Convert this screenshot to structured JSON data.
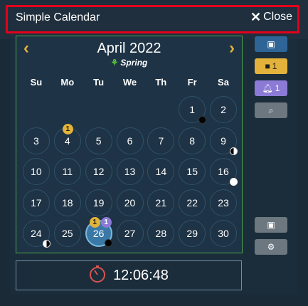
{
  "window": {
    "title": "Simple Calendar",
    "close_label": "Close"
  },
  "calendar": {
    "month_title": "April 2022",
    "season": "Spring",
    "weekdays": [
      "Su",
      "Mo",
      "Tu",
      "We",
      "Th",
      "Fr",
      "Sa"
    ],
    "days": [
      {
        "n": "1",
        "moon": "new"
      },
      {
        "n": "2"
      },
      {
        "n": "3"
      },
      {
        "n": "4",
        "notes": "1"
      },
      {
        "n": "5"
      },
      {
        "n": "6"
      },
      {
        "n": "7"
      },
      {
        "n": "8"
      },
      {
        "n": "9",
        "moon": "first"
      },
      {
        "n": "10"
      },
      {
        "n": "11"
      },
      {
        "n": "12"
      },
      {
        "n": "13"
      },
      {
        "n": "14"
      },
      {
        "n": "15"
      },
      {
        "n": "16",
        "moon": "full"
      },
      {
        "n": "17"
      },
      {
        "n": "18"
      },
      {
        "n": "19"
      },
      {
        "n": "20"
      },
      {
        "n": "21"
      },
      {
        "n": "22"
      },
      {
        "n": "23"
      },
      {
        "n": "24",
        "moon": "last"
      },
      {
        "n": "25"
      },
      {
        "n": "26",
        "notes": "1",
        "reminders": "1",
        "today": true,
        "moon": "new"
      },
      {
        "n": "27"
      },
      {
        "n": "28"
      },
      {
        "n": "29"
      },
      {
        "n": "30"
      }
    ],
    "first_weekday_index": 5
  },
  "sidebar": {
    "notes_count": "1",
    "reminders_count": "1"
  },
  "clock": {
    "time": "12:06:48"
  },
  "colors": {
    "accent_yellow": "#e2b23a",
    "accent_purple": "#8c7bd6",
    "calendar_border": "#4ea64d",
    "highlight_red": "#e3001b"
  },
  "icons": [
    "close-icon",
    "chevron-left-icon",
    "chevron-right-icon",
    "sprout-icon",
    "calendar-icon",
    "note-icon",
    "bell-icon",
    "search-icon",
    "calendar-add-icon",
    "gear-icon",
    "stopwatch-icon"
  ]
}
